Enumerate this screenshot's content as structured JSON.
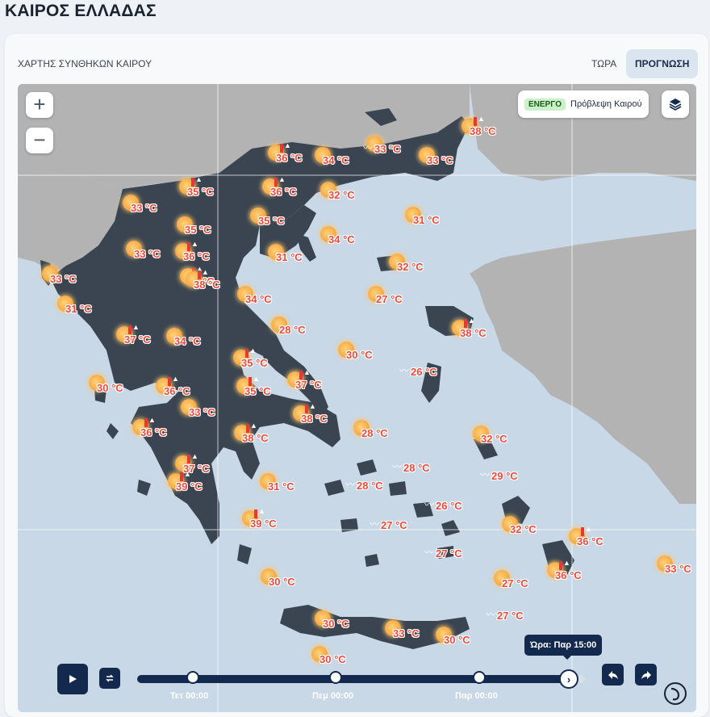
{
  "page": {
    "title": "ΚΑΙΡΟΣ ΕΛΛΑΔΑΣ"
  },
  "map_header": {
    "title": "ΧΑΡΤΗΣ ΣΥΝΘΗΚΩΝ ΚΑΙΡΟΥ",
    "tab_now": "ΤΩΡΑ",
    "tab_forecast": "ΠΡΟΓΝΩΣΗ",
    "active_tab": "ΠΡΟΓΝΩΣΗ"
  },
  "controls": {
    "zoom_in": "+",
    "zoom_out": "−",
    "layer_badge": "ΕΝΕΡΓΟ",
    "layer_name": "Πρόβλεψη Καιρού",
    "layers_icon": "layers-icon"
  },
  "colors": {
    "land": "#3b4551",
    "sea": "#c9d8e6",
    "neighbor": "#b3b3b3",
    "accent": "#132a4e",
    "temp_text": "#e74c3c"
  },
  "weather": [
    {
      "temp": "38 °C",
      "icon": "sun-icon",
      "alert": true
    },
    {
      "temp": "36 °C",
      "icon": "sun-icon",
      "alert": true
    },
    {
      "temp": "34 °C",
      "icon": "sun-icon",
      "alert": false
    },
    {
      "temp": "33 °C",
      "icon": "sun-wind-icon",
      "alert": false
    },
    {
      "temp": "33 °C",
      "icon": "sun-icon",
      "alert": false
    },
    {
      "temp": "35 °C",
      "icon": "sun-icon",
      "alert": true
    },
    {
      "temp": "36 °C",
      "icon": "sun-icon",
      "alert": true
    },
    {
      "temp": "32 °C",
      "icon": "sun-icon",
      "alert": false
    },
    {
      "temp": "33 °C",
      "icon": "sun-icon",
      "alert": false
    },
    {
      "temp": "35 °C",
      "icon": "sun-icon",
      "alert": false
    },
    {
      "temp": "35 °C",
      "icon": "sun-icon",
      "alert": false
    },
    {
      "temp": "31 °C",
      "icon": "sun-icon",
      "alert": false
    },
    {
      "temp": "34 °C",
      "icon": "sun-icon",
      "alert": false
    },
    {
      "temp": "33 °C",
      "icon": "sun-icon",
      "alert": false
    },
    {
      "temp": "36 °C",
      "icon": "sun-icon",
      "alert": true
    },
    {
      "temp": "31 °C",
      "icon": "sun-icon",
      "alert": false
    },
    {
      "temp": "32 °C",
      "icon": "sun-icon",
      "alert": false
    },
    {
      "temp": "33 °C",
      "icon": "sun-icon",
      "alert": false
    },
    {
      "temp": "35 °C",
      "icon": "sun-icon",
      "alert": true
    },
    {
      "temp": "38 °C",
      "icon": "sun-icon",
      "alert": true
    },
    {
      "temp": "34 °C",
      "icon": "sun-icon",
      "alert": false
    },
    {
      "temp": "27 °C",
      "icon": "sun-icon",
      "alert": false
    },
    {
      "temp": "31 °C",
      "icon": "sun-icon",
      "alert": false
    },
    {
      "temp": "28 °C",
      "icon": "sun-icon",
      "alert": false
    },
    {
      "temp": "37 °C",
      "icon": "sun-icon",
      "alert": true
    },
    {
      "temp": "34 °C",
      "icon": "sun-icon",
      "alert": false
    },
    {
      "temp": "38 °C",
      "icon": "sun-icon",
      "alert": true
    },
    {
      "temp": "30 °C",
      "icon": "sun-icon",
      "alert": false
    },
    {
      "temp": "35 °C",
      "icon": "sun-icon",
      "alert": true
    },
    {
      "temp": "26 °C",
      "icon": "wind-icon",
      "alert": false
    },
    {
      "temp": "30 °C",
      "icon": "sun-icon",
      "alert": false
    },
    {
      "temp": "36 °C",
      "icon": "sun-icon",
      "alert": true
    },
    {
      "temp": "35 °C",
      "icon": "sun-icon",
      "alert": true
    },
    {
      "temp": "37 °C",
      "icon": "sun-icon",
      "alert": true
    },
    {
      "temp": "33 °C",
      "icon": "sun-icon",
      "alert": false
    },
    {
      "temp": "38 °C",
      "icon": "sun-icon",
      "alert": true
    },
    {
      "temp": "36 °C",
      "icon": "sun-icon",
      "alert": true
    },
    {
      "temp": "28 °C",
      "icon": "sun-icon",
      "alert": false
    },
    {
      "temp": "32 °C",
      "icon": "sun-icon",
      "alert": false
    },
    {
      "temp": "38 °C",
      "icon": "sun-icon",
      "alert": true
    },
    {
      "temp": "28 °C",
      "icon": "wind-icon",
      "alert": false
    },
    {
      "temp": "29 °C",
      "icon": "wind-icon",
      "alert": false
    },
    {
      "temp": "37 °C",
      "icon": "sun-icon",
      "alert": true
    },
    {
      "temp": "28 °C",
      "icon": "wind-icon",
      "alert": false
    },
    {
      "temp": "31 °C",
      "icon": "sun-icon",
      "alert": false
    },
    {
      "temp": "26 °C",
      "icon": "wind-icon",
      "alert": false
    },
    {
      "temp": "39 °C",
      "icon": "sun-icon",
      "alert": true
    },
    {
      "temp": "39 °C",
      "icon": "sun-icon",
      "alert": true
    },
    {
      "temp": "27 °C",
      "icon": "wind-icon",
      "alert": false
    },
    {
      "temp": "32 °C",
      "icon": "sun-icon",
      "alert": false
    },
    {
      "temp": "36 °C",
      "icon": "sun-icon",
      "alert": true
    },
    {
      "temp": "27 °C",
      "icon": "wind-icon",
      "alert": false
    },
    {
      "temp": "33 °C",
      "icon": "sun-icon",
      "alert": false
    },
    {
      "temp": "36 °C",
      "icon": "sun-icon",
      "alert": true
    },
    {
      "temp": "30 °C",
      "icon": "sun-icon",
      "alert": false
    },
    {
      "temp": "27 °C",
      "icon": "sun-icon",
      "alert": false
    },
    {
      "temp": "27 °C",
      "icon": "wind-icon",
      "alert": false
    },
    {
      "temp": "30 °C",
      "icon": "sun-icon",
      "alert": false
    },
    {
      "temp": "33 °C",
      "icon": "sun-icon",
      "alert": false
    },
    {
      "temp": "30 °C",
      "icon": "sun-icon",
      "alert": false
    },
    {
      "temp": "30 °C",
      "icon": "sun-icon",
      "alert": false
    }
  ],
  "timeline": {
    "tooltip": "Ώρα: Παρ 15:00",
    "labels": [
      "Τετ 00:00",
      "Πεμ 00:00",
      "Παρ 00:00"
    ],
    "progress": 0.965,
    "play_icon": "play-icon",
    "loop_icon": "loop-icon",
    "prev_icon": "rewind-icon",
    "next_icon": "forward-icon"
  }
}
